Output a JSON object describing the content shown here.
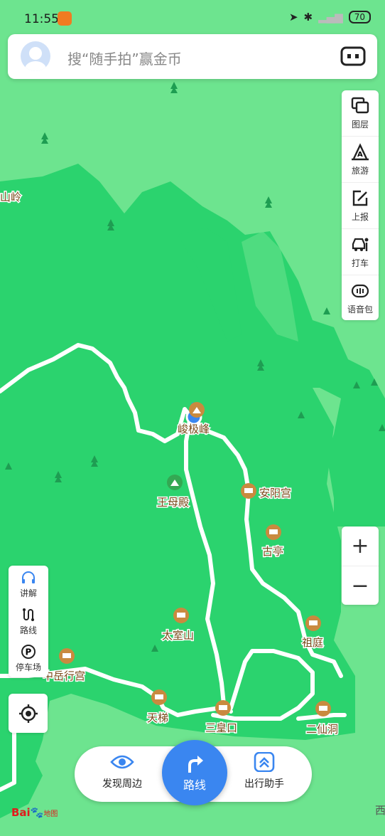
{
  "status_bar": {
    "time": "11:55",
    "battery": "70"
  },
  "search": {
    "placeholder": "搜“随手拍”赢金币"
  },
  "right_toolbar": {
    "items": [
      {
        "label": "图层",
        "icon": "layers-icon"
      },
      {
        "label": "旅游",
        "icon": "travel-icon"
      },
      {
        "label": "上报",
        "icon": "report-icon"
      },
      {
        "label": "打车",
        "icon": "taxi-icon"
      },
      {
        "label": "语音包",
        "icon": "voice-pack-icon"
      }
    ]
  },
  "zoom": {
    "in": "+",
    "out": "−"
  },
  "left_toolbar": {
    "items": [
      {
        "label": "讲解",
        "icon": "headphones-icon"
      },
      {
        "label": "路线",
        "icon": "route-icon"
      },
      {
        "label": "停车场",
        "icon": "parking-icon"
      }
    ]
  },
  "map": {
    "pois": [
      {
        "label": "峻极峰",
        "icon": "peak-icon"
      },
      {
        "label": "王母殿",
        "icon": "scenic-icon"
      },
      {
        "label": "安阳宫",
        "icon": "temple-icon"
      },
      {
        "label": "古亭",
        "icon": "building-icon"
      },
      {
        "label": "太室山",
        "icon": "building-icon"
      },
      {
        "label": "祖庭",
        "icon": "building-icon"
      },
      {
        "label": "中岳行宫",
        "icon": "temple-icon"
      },
      {
        "label": "天梯",
        "icon": "building-icon"
      },
      {
        "label": "三皇口",
        "icon": "building-icon"
      },
      {
        "label": "二仙洞",
        "icon": "building-icon"
      }
    ],
    "edge_labels": {
      "left_top": "山岭",
      "bottom_right": "西"
    }
  },
  "bottom_bar": {
    "discover_label": "发现周边",
    "route_label": "路线",
    "assistant_label": "出行助手"
  },
  "logo": {
    "brand": "Bai",
    "suffix": "地图"
  },
  "colors": {
    "accent": "#3a86f0",
    "map_light": "#6de48f",
    "map_dark": "#2bd36e",
    "poi": "#c98a3f"
  }
}
